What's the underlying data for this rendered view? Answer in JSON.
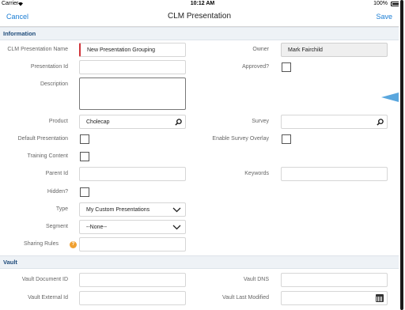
{
  "status_bar": {
    "carrier": "Carrier",
    "time": "10:12 AM",
    "battery": "100%"
  },
  "navbar": {
    "cancel_label": "Cancel",
    "title": "CLM Presentation",
    "save_label": "Save"
  },
  "sections": {
    "information": "Information",
    "vault": "Vault"
  },
  "fields": {
    "clm_presentation_name": {
      "label": "CLM Presentation Name",
      "value": "New Presentation Grouping"
    },
    "owner": {
      "label": "Owner",
      "value": "Mark Fairchild"
    },
    "presentation_id": {
      "label": "Presentation Id",
      "value": ""
    },
    "approved": {
      "label": "Approved?",
      "checked": false
    },
    "description": {
      "label": "Description",
      "value": ""
    },
    "product": {
      "label": "Product",
      "value": "Cholecap"
    },
    "survey": {
      "label": "Survey",
      "value": ""
    },
    "default_presentation": {
      "label": "Default Presentation",
      "checked": false
    },
    "enable_survey_overlay": {
      "label": "Enable Survey Overlay",
      "checked": false
    },
    "training_content": {
      "label": "Training Content",
      "checked": false
    },
    "parent_id": {
      "label": "Parent Id",
      "value": ""
    },
    "keywords": {
      "label": "Keywords",
      "value": ""
    },
    "hidden": {
      "label": "Hidden?",
      "checked": false
    },
    "type": {
      "label": "Type",
      "value": "My Custom Presentations"
    },
    "segment": {
      "label": "Segment",
      "value": "--None--"
    },
    "sharing_rules": {
      "label": "Sharing Rules",
      "value": ""
    },
    "vault_document_id": {
      "label": "Vault Document ID",
      "value": ""
    },
    "vault_dns": {
      "label": "Vault DNS",
      "value": ""
    },
    "vault_external_id": {
      "label": "Vault External Id",
      "value": ""
    },
    "vault_last_modified": {
      "label": "Vault Last Modified",
      "value": ""
    }
  },
  "colors": {
    "accent": "#1a7dd4",
    "required": "#d0343a",
    "section_text": "#1e4b7a",
    "help": "#f0a030",
    "pointer": "#5aa7de"
  },
  "icons": {
    "search": "search-icon",
    "chevron": "chevron-down-icon",
    "calendar": "calendar-icon",
    "help": "help-icon",
    "wifi": "wifi-icon"
  }
}
